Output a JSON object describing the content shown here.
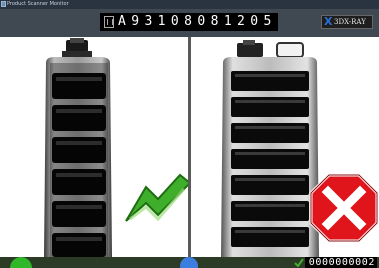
{
  "window": {
    "title": "Product Scanner Monitor"
  },
  "header": {
    "barcode": "A93108081205",
    "brand_x": "X",
    "brand_text": "3DX-RAY"
  },
  "panels": [
    {
      "name": "left",
      "result": "pass",
      "result_icon": "green-checkmark-icon"
    },
    {
      "name": "right",
      "result": "fail",
      "result_icon": "red-x-icon"
    }
  ],
  "status": {
    "counter": "0000000002"
  },
  "colors": {
    "pass": "#3fae2a",
    "fail": "#e0141b",
    "header": "#404852"
  }
}
